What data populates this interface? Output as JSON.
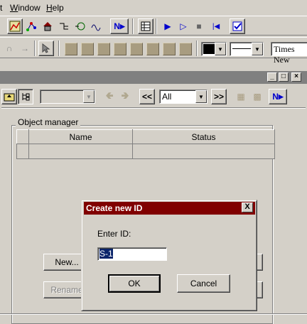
{
  "menu": {
    "item_partial": "t",
    "window": "Window",
    "help": "Help"
  },
  "toolbar1": {
    "icons": [
      "chart-icon",
      "graph-icon",
      "house-icon",
      "split-icon",
      "node-icon",
      "wave-icon",
      "n-next-icon",
      "table-icon",
      "play-icon",
      "step-icon",
      "stop-icon",
      "rewind-icon",
      "checklist-icon"
    ],
    "n_label": "N"
  },
  "toolbar2": {
    "font": "Times New",
    "color_value": "black"
  },
  "panel": {
    "filter_value": "All",
    "nav_back": "<<",
    "nav_forward": ">>",
    "n_label": "N"
  },
  "object_manager": {
    "title": "Object manager",
    "columns": [
      "Name",
      "Status"
    ],
    "buttons": {
      "new": "New...",
      "rename": "Rename"
    }
  },
  "dialog": {
    "title": "Create new ID",
    "close": "X",
    "prompt": "Enter ID:",
    "value": "S-1",
    "ok": "OK",
    "cancel": "Cancel"
  },
  "colors": {
    "title_bar": "#800000",
    "selection": "#0a246a",
    "face": "#d4d0c8"
  }
}
